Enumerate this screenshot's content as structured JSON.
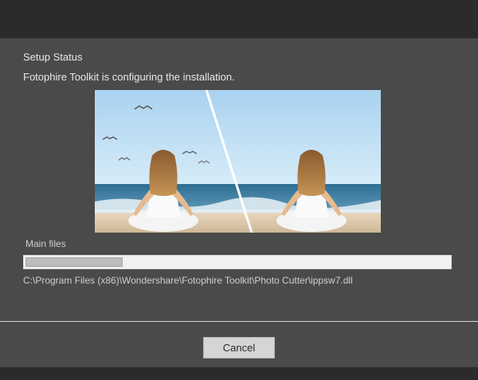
{
  "dialog": {
    "heading": "Setup Status",
    "subheading": "Fotophire Toolkit is configuring the installation."
  },
  "progress": {
    "label": "Main files",
    "fraction": 0.23,
    "current_file": "C:\\Program Files (x86)\\Wondershare\\Fotophire Toolkit\\Photo Cutter\\ippsw7.dll"
  },
  "footer": {
    "cancel_label": "Cancel"
  },
  "colors": {
    "panel": "#4a4a4a",
    "progress_fill": "#bdbdbd",
    "progress_track": "#f1f1f1"
  }
}
